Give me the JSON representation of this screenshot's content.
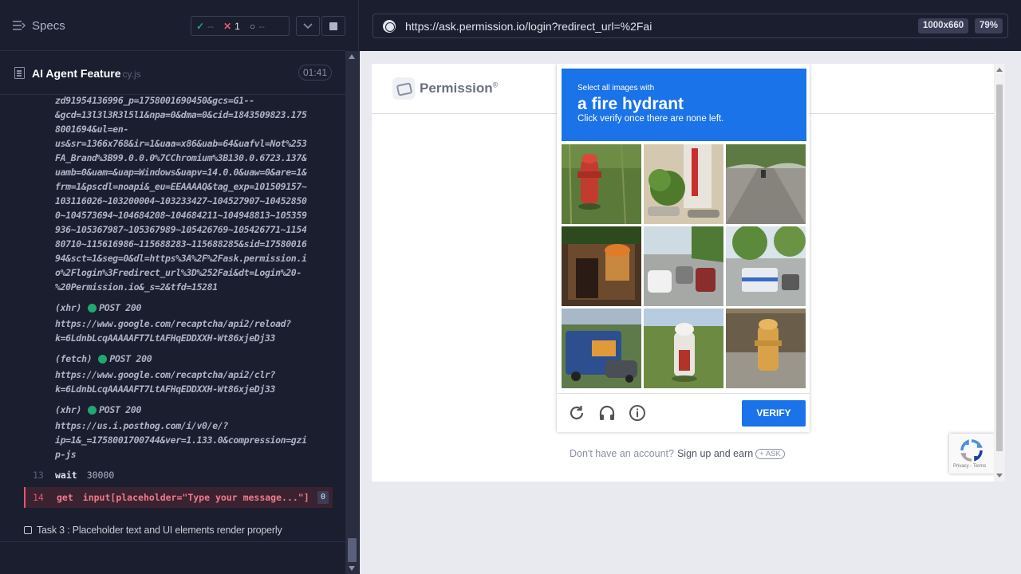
{
  "sidebar": {
    "title": "Specs",
    "stats": {
      "passed": "--",
      "failed": "1",
      "pending": "--"
    },
    "file": {
      "name": "AI Agent Feature",
      "ext": "cy.js",
      "duration": "01:41"
    },
    "log_block": "zd91954136996_p=1758001690450&gcs=G1--\n&gcd=13l3l3R3l5l1&npa=0&dma=0&cid=1843509823.175\n8001694&ul=en-\nus&sr=1366x768&ir=1&uaa=x86&uab=64&uafvl=Not%253\nFA_Brand%3B99.0.0.0%7CChromium%3B130.0.6723.137&\nuamb=0&uam=&uap=Windows&uapv=14.0.0&uaw=0&are=1&\nfrm=1&pscdl=noapi&_eu=EEAAAAQ&tag_exp=101509157~\n103116026~103200004~103233427~104527907~10452850\n0~104573694~104684208~104684211~104948813~105359\n936~105367987~105367989~105426769~105426771~1154\n80710~115616986~115688283~115688285&sid=17580016\n94&sct=1&seg=0&dl=https%3A%2F%2Fask.permission.i\no%2Flogin%3Fredirect_url%3D%252Fai&dt=Login%20-\n%20Permission.io&_s=2&tfd=15281",
    "requests": [
      {
        "kind": "(xhr)",
        "method": "POST 200",
        "url": "https://www.google.com/recaptcha/api2/reload?\nk=6LdnbLcqAAAAAFT7LtAFHqEDDXXH-Wt86xjeDj33"
      },
      {
        "kind": "(fetch)",
        "method": "POST 200",
        "url": "https://www.google.com/recaptcha/api2/clr?\nk=6LdnbLcqAAAAAFT7LtAFHqEDDXXH-Wt86xjeDj33"
      },
      {
        "kind": "(xhr)",
        "method": "POST 200",
        "url": "https://us.i.posthog.com/i/v0/e/?\nip=1&_=1758001700744&ver=1.133.0&compression=gzi\np-js"
      }
    ],
    "commands": [
      {
        "num": "13",
        "name": "wait",
        "arg": "30000"
      },
      {
        "num": "14",
        "name": "get",
        "arg": "input[placeholder=\"Type your message...\"]",
        "badge": "0"
      }
    ],
    "task": "Task 3 : Placeholder text and UI elements render properly"
  },
  "browser": {
    "url": "https://ask.permission.io/login?redirect_url=%2Fai",
    "viewport": "1000x660",
    "zoom": "79%"
  },
  "page": {
    "brand": "Permission",
    "brand_mark": "®",
    "signup_prefix": "Don't have an account?",
    "signup_link": "Sign up and earn",
    "signup_pill": "+ ASK"
  },
  "captcha": {
    "instruction_small": "Select all images with",
    "target": "a fire hydrant",
    "instruction_sub": "Click verify once there are none left.",
    "verify_label": "VERIFY",
    "tiles": [
      "fire hydrant on grass",
      "scooters and bushes",
      "empty road",
      "storefront",
      "street with cars",
      "bus on street",
      "blue bus",
      "white fire hydrant",
      "yellow fire hydrant"
    ],
    "badge_terms": "Privacy - Terms"
  }
}
